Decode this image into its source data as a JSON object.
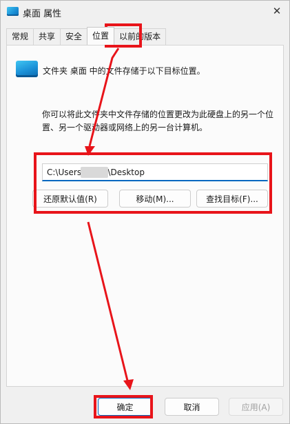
{
  "window": {
    "title": "桌面 属性",
    "close_glyph": "✕"
  },
  "tabs": [
    {
      "label": "常规"
    },
    {
      "label": "共享"
    },
    {
      "label": "安全"
    },
    {
      "label": "位置",
      "active": true
    },
    {
      "label": "以前的版本"
    }
  ],
  "location": {
    "info": "文件夹 桌面 中的文件存储于以下目标位置。",
    "description": "你可以将此文件夹中文件存储的位置更改为此硬盘上的另一个位置、另一个驱动器或网络上的另一台计算机。",
    "path_value": "C:\\Users\\         \\Desktop",
    "restore_label": "还原默认值(R)",
    "move_label": "移动(M)...",
    "find_target_label": "查找目标(F)..."
  },
  "footer": {
    "ok_label": "确定",
    "cancel_label": "取消",
    "apply_label": "应用(A)"
  },
  "colors": {
    "annotation_red": "#e8141a",
    "accent": "#0067c0",
    "folder_blue": "#1b91d8"
  },
  "icons": {
    "title": "desktop-folder-icon",
    "close": "close-icon",
    "folder": "desktop-folder-icon"
  }
}
